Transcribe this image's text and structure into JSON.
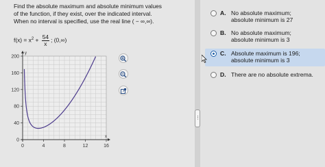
{
  "question": {
    "text": "Find the absolute maximum and absolute minimum values\nof the function, if they exist, over the indicated interval.\nWhen no interval is specified, use the real line ( − ∞,∞)."
  },
  "function": {
    "lhs": "f(x) = x",
    "exponent": "2",
    "plus": "+",
    "numerator": "54",
    "denominator": "x",
    "interval": "; (0,∞)"
  },
  "graph": {
    "x_axis_label": "x",
    "y_axis_label": "y",
    "x_ticks": [
      "0",
      "4",
      "8",
      "12",
      "16"
    ],
    "y_ticks": [
      "0",
      "40",
      "80",
      "120",
      "160",
      "200"
    ],
    "xlim": [
      0,
      16
    ],
    "ylim": [
      0,
      200
    ],
    "curve_color": "#4b3a8c",
    "axis_color": "#333333"
  },
  "tools": {
    "zoom_in_icon": "zoom-in-icon",
    "zoom_out_icon": "zoom-out-icon",
    "popout_icon": "external-link-icon"
  },
  "choices": [
    {
      "letter": "A.",
      "text": "No absolute maximum;\nabsolute minimum is 27",
      "selected": false
    },
    {
      "letter": "B.",
      "text": "No absolute maximum;\nabsolute minimum is 3",
      "selected": false
    },
    {
      "letter": "C.",
      "text": "Absolute maximum is 196;\nabsolute minimum is 3",
      "selected": true
    },
    {
      "letter": "D.",
      "text": "There are no absolute extrema.",
      "selected": false
    }
  ],
  "divider_handle": "⋮",
  "highlight_color": "#c6d8ee"
}
